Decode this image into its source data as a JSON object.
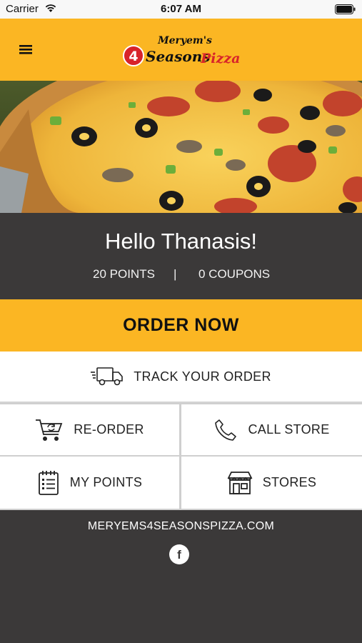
{
  "status_bar": {
    "carrier": "Carrier",
    "time": "6:07 AM"
  },
  "header": {
    "logo": {
      "line1": "Meryem's",
      "line2": "Seasons",
      "line3": "Pizza",
      "badge": "4"
    }
  },
  "profile": {
    "greeting": "Hello Thanasis!",
    "points": "20 POINTS",
    "separator": "|",
    "coupons": "0 COUPONS"
  },
  "actions": {
    "order_now": "ORDER NOW",
    "track_order": "TRACK YOUR ORDER",
    "reorder": "RE-ORDER",
    "call_store": "CALL STORE",
    "my_points": "MY POINTS",
    "stores": "STORES"
  },
  "footer": {
    "website": "MERYEMS4SEASONSPIZZA.COM",
    "facebook": "f"
  },
  "colors": {
    "accent": "#fbb623",
    "dark": "#3b3939",
    "white": "#ffffff",
    "logo_red": "#d8232a"
  }
}
